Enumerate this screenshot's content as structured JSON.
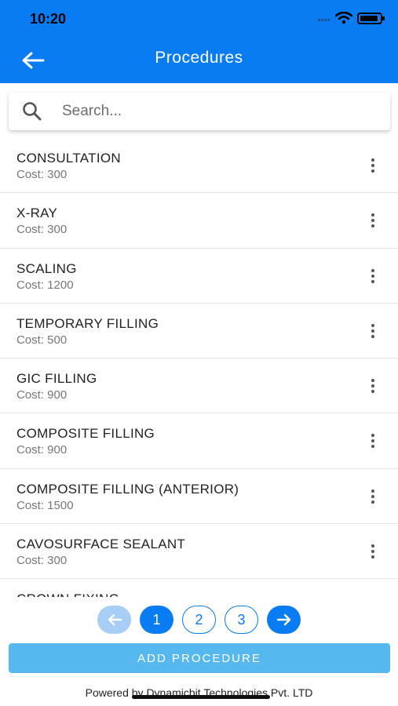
{
  "status_bar": {
    "time": "10:20"
  },
  "header": {
    "title": "Procedures"
  },
  "search": {
    "placeholder": "Search..."
  },
  "procedures": [
    {
      "name": "CONSULTATION",
      "cost": "Cost: 300"
    },
    {
      "name": "X-RAY",
      "cost": "Cost: 300"
    },
    {
      "name": "SCALING",
      "cost": "Cost: 1200"
    },
    {
      "name": "TEMPORARY FILLING",
      "cost": "Cost: 500"
    },
    {
      "name": "GIC FILLING",
      "cost": "Cost: 900"
    },
    {
      "name": "COMPOSITE FILLING",
      "cost": "Cost: 900"
    },
    {
      "name": "COMPOSITE FILLING (ANTERIOR)",
      "cost": "Cost: 1500"
    },
    {
      "name": "CAVOSURFACE SEALANT",
      "cost": "Cost: 300"
    },
    {
      "name": "CROWN FIXING",
      "cost": ""
    }
  ],
  "pagination": {
    "pages": [
      "1",
      "2",
      "3"
    ],
    "current": "1"
  },
  "actions": {
    "add_label": "ADD PROCEDURE"
  },
  "footer": {
    "text": "Powered by Dynamicbit Technologies Pvt. LTD"
  },
  "colors": {
    "primary": "#0a7cf3",
    "button": "#56b8ee",
    "prev_disabled": "#a7cff6"
  }
}
